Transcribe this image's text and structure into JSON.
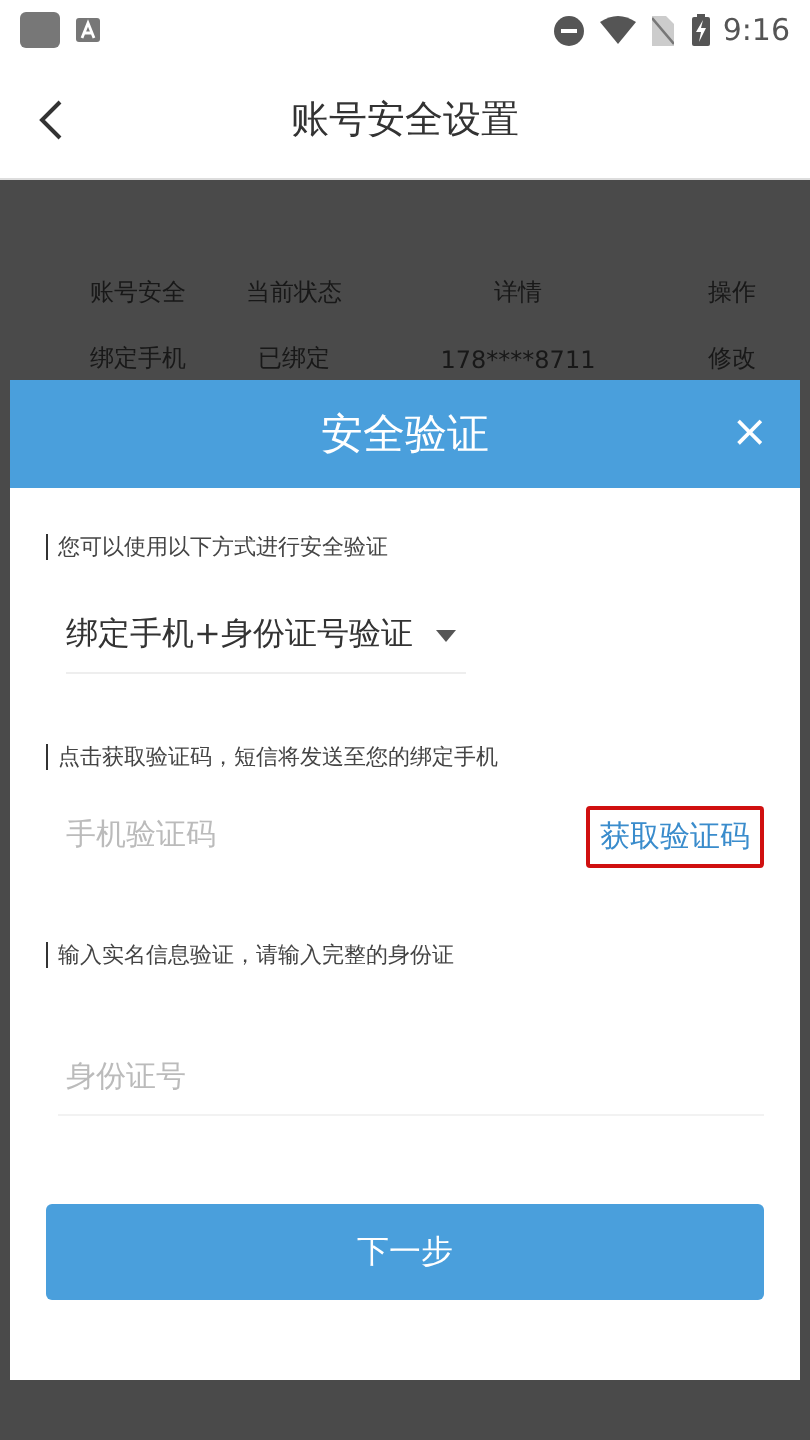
{
  "status_bar": {
    "time": "9:16"
  },
  "app_bar": {
    "title": "账号安全设置"
  },
  "table": {
    "columns": [
      "账号安全",
      "当前状态",
      "详情",
      "操作"
    ],
    "rows": [
      {
        "cells": [
          "绑定手机",
          "已绑定",
          "178****8711",
          "修改"
        ]
      }
    ]
  },
  "dialog": {
    "title": "安全验证",
    "close": "×",
    "sections": [
      {
        "kind": "select",
        "hint": "您可以使用以下方式进行安全验证",
        "value": "绑定手机+身份证号验证"
      },
      {
        "kind": "code",
        "hint": "点击获取验证码，短信将发送至您的绑定手机",
        "placeholder": "手机验证码",
        "button": "获取验证码",
        "highlighted": true
      },
      {
        "kind": "text",
        "hint": "输入实名信息验证，请输入完整的身份证",
        "placeholder": "身份证号"
      }
    ],
    "submit": "下一步"
  }
}
